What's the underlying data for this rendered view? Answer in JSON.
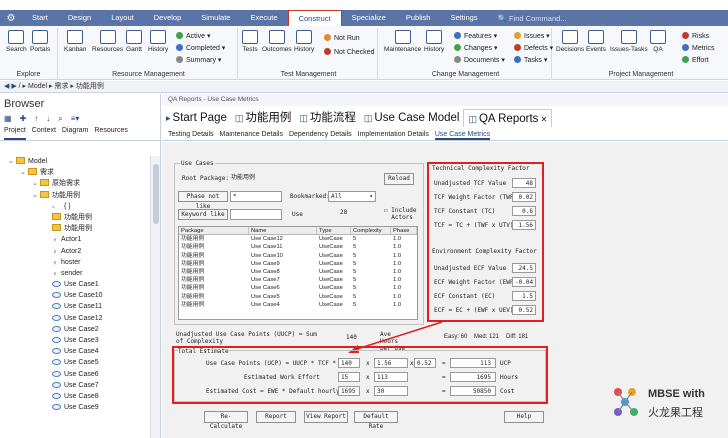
{
  "menubar": {
    "tabs": [
      "Start",
      "Design",
      "Layout",
      "Develop",
      "Simulate",
      "Execute",
      "Construct",
      "Specialize",
      "Publish",
      "Settings"
    ],
    "active": "Construct",
    "find": "Find Command..."
  },
  "ribbon": {
    "explore": {
      "label": "Explore",
      "buttons": [
        "Search",
        "Portals"
      ]
    },
    "resource": {
      "label": "Resource Management",
      "buttons": [
        "Kanban",
        "Resources",
        "Gantt",
        "History"
      ],
      "items": [
        "Active",
        "Completed",
        "Summary"
      ]
    },
    "test": {
      "label": "Test Management",
      "buttons": [
        "Tests",
        "Outcomes",
        "History"
      ],
      "items": [
        "Not Run",
        "Not Checked"
      ]
    },
    "change": {
      "label": "Change Management",
      "buttons": [
        "Maintenance",
        "History"
      ],
      "items": [
        "Features",
        "Changes",
        "Documents"
      ]
    },
    "project": {
      "label": "Project Management",
      "buttons": [
        "Decisions",
        "Events",
        "Issues-Tasks",
        "QA"
      ],
      "items_a": [
        "Issues",
        "Defects",
        "Tasks"
      ],
      "items_b": [
        "Risks",
        "Metrics",
        "Effort"
      ]
    }
  },
  "address": "/ ▸ Model ▸ 需求 ▸ 功能用例",
  "browser": {
    "title": "Browser",
    "tabs": [
      "Project",
      "Context",
      "Diagram",
      "Resources"
    ],
    "tree": [
      {
        "t": "Model",
        "d": 0,
        "i": "pkg"
      },
      {
        "t": "需求",
        "d": 1,
        "i": "pkg"
      },
      {
        "t": "原始需求",
        "d": 2,
        "i": "pkg"
      },
      {
        "t": "功能用例",
        "d": 2,
        "i": "pkg"
      },
      {
        "t": "{ }",
        "d": 3,
        "i": "none"
      },
      {
        "t": "功能用例",
        "d": 3,
        "i": "pkg"
      },
      {
        "t": "功能用例",
        "d": 3,
        "i": "pkg"
      },
      {
        "t": "Actor1",
        "d": 3,
        "i": "actor"
      },
      {
        "t": "Actor2",
        "d": 3,
        "i": "actor"
      },
      {
        "t": "hoster",
        "d": 3,
        "i": "actor"
      },
      {
        "t": "sender",
        "d": 3,
        "i": "actor"
      },
      {
        "t": "Use Case1",
        "d": 3,
        "i": "uc"
      },
      {
        "t": "Use Case10",
        "d": 3,
        "i": "uc"
      },
      {
        "t": "Use Case11",
        "d": 3,
        "i": "uc"
      },
      {
        "t": "Use Case12",
        "d": 3,
        "i": "uc"
      },
      {
        "t": "Use Case2",
        "d": 3,
        "i": "uc"
      },
      {
        "t": "Use Case3",
        "d": 3,
        "i": "uc"
      },
      {
        "t": "Use Case4",
        "d": 3,
        "i": "uc"
      },
      {
        "t": "Use Case5",
        "d": 3,
        "i": "uc"
      },
      {
        "t": "Use Case6",
        "d": 3,
        "i": "uc"
      },
      {
        "t": "Use Case7",
        "d": 3,
        "i": "uc"
      },
      {
        "t": "Use Case8",
        "d": 3,
        "i": "uc"
      },
      {
        "t": "Use Case9",
        "d": 3,
        "i": "uc"
      }
    ]
  },
  "docbar": "QA Reports - Use Case Metrics",
  "doctabs": [
    "Start Page",
    "功能用例",
    "功能流程",
    "Use Case Model",
    "QA Reports"
  ],
  "subtabs": [
    "Testing Details",
    "Maintenance Details",
    "Dependency Details",
    "Implementation Details",
    "Use Case Metrics"
  ],
  "usecases": {
    "group": "Use Cases",
    "root_label": "Root Package:",
    "root_value": "功能用例",
    "reload": "Reload",
    "phase_btn": "Phase not like",
    "phase_val": "*",
    "bookmarked": "Bookmarked:",
    "bookmarked_val": "All",
    "keyword_btn": "Keyword like",
    "use_label": "Use",
    "use_count": "28",
    "include": "Include Actors"
  },
  "table": {
    "headers": [
      "Package",
      "Name",
      "Type",
      "Complexity",
      "Phase"
    ],
    "rows": [
      [
        "功能用例",
        "Use Case12",
        "UseCase",
        "5",
        "1.0"
      ],
      [
        "功能用例",
        "Use Case11",
        "UseCase",
        "5",
        "1.0"
      ],
      [
        "功能用例",
        "Use Case10",
        "UseCase",
        "5",
        "1.0"
      ],
      [
        "功能用例",
        "Use Case9",
        "UseCase",
        "5",
        "1.0"
      ],
      [
        "功能用例",
        "Use Case8",
        "UseCase",
        "5",
        "1.0"
      ],
      [
        "功能用例",
        "Use Case7",
        "UseCase",
        "5",
        "1.0"
      ],
      [
        "功能用例",
        "Use Case6",
        "UseCase",
        "5",
        "1.0"
      ],
      [
        "功能用例",
        "Use Case5",
        "UseCase",
        "5",
        "1.0"
      ],
      [
        "功能用例",
        "Use Case4",
        "UseCase",
        "5",
        "1.0"
      ]
    ]
  },
  "tcf": {
    "group": "Technical Complexity Factor",
    "rows": [
      {
        "l": "Unadjusted TCF Value",
        "v": "48"
      },
      {
        "l": "TCF Weight Factor (TWF)",
        "v": "0.02"
      },
      {
        "l": "TCF Constant (TC)",
        "v": "0.6"
      },
      {
        "l": "TCF = TC + (TWF x UTV)",
        "v": "1.56"
      }
    ]
  },
  "ecf": {
    "group": "Environment Complexity Factor",
    "rows": [
      {
        "l": "Unadjusted ECF Value",
        "v": "24.5"
      },
      {
        "l": "ECF Weight Factor (EWF)",
        "v": "-0.04"
      },
      {
        "l": "ECF Constant (EC)",
        "v": "1.5"
      },
      {
        "l": "ECF = EC + (EWF x UEV)",
        "v": "0.52"
      }
    ]
  },
  "uucp": {
    "label": "Unadjusted Use Case Points (UUCP) = Sum of Complexity",
    "value": "140",
    "ave_label": "Ave Hours per Use",
    "easy": "Easy: 60",
    "med": "Med: 121",
    "diff": "Diff: 181"
  },
  "estimate": {
    "group": "Total Estimate",
    "ucp": {
      "label": "Use Case Points (UCP) = UUCP * TCF * ECF",
      "a": "140",
      "b": "1.56",
      "c": "0.52",
      "r": "113",
      "unit": "UCP"
    },
    "effort": {
      "label": "Estimated Work Effort",
      "a": "15",
      "b": "113",
      "r": "1695",
      "unit": "Hours"
    },
    "cost": {
      "label": "Estimated Cost = EWE * Default hourly",
      "a": "1695",
      "b": "30",
      "r": "50850",
      "unit": "Cost"
    }
  },
  "buttons": [
    "Re-Calculate",
    "Report",
    "View Report",
    "Default Rate",
    "Help"
  ],
  "logo": {
    "line1": "MBSE with",
    "line2": "火龙果工程"
  }
}
